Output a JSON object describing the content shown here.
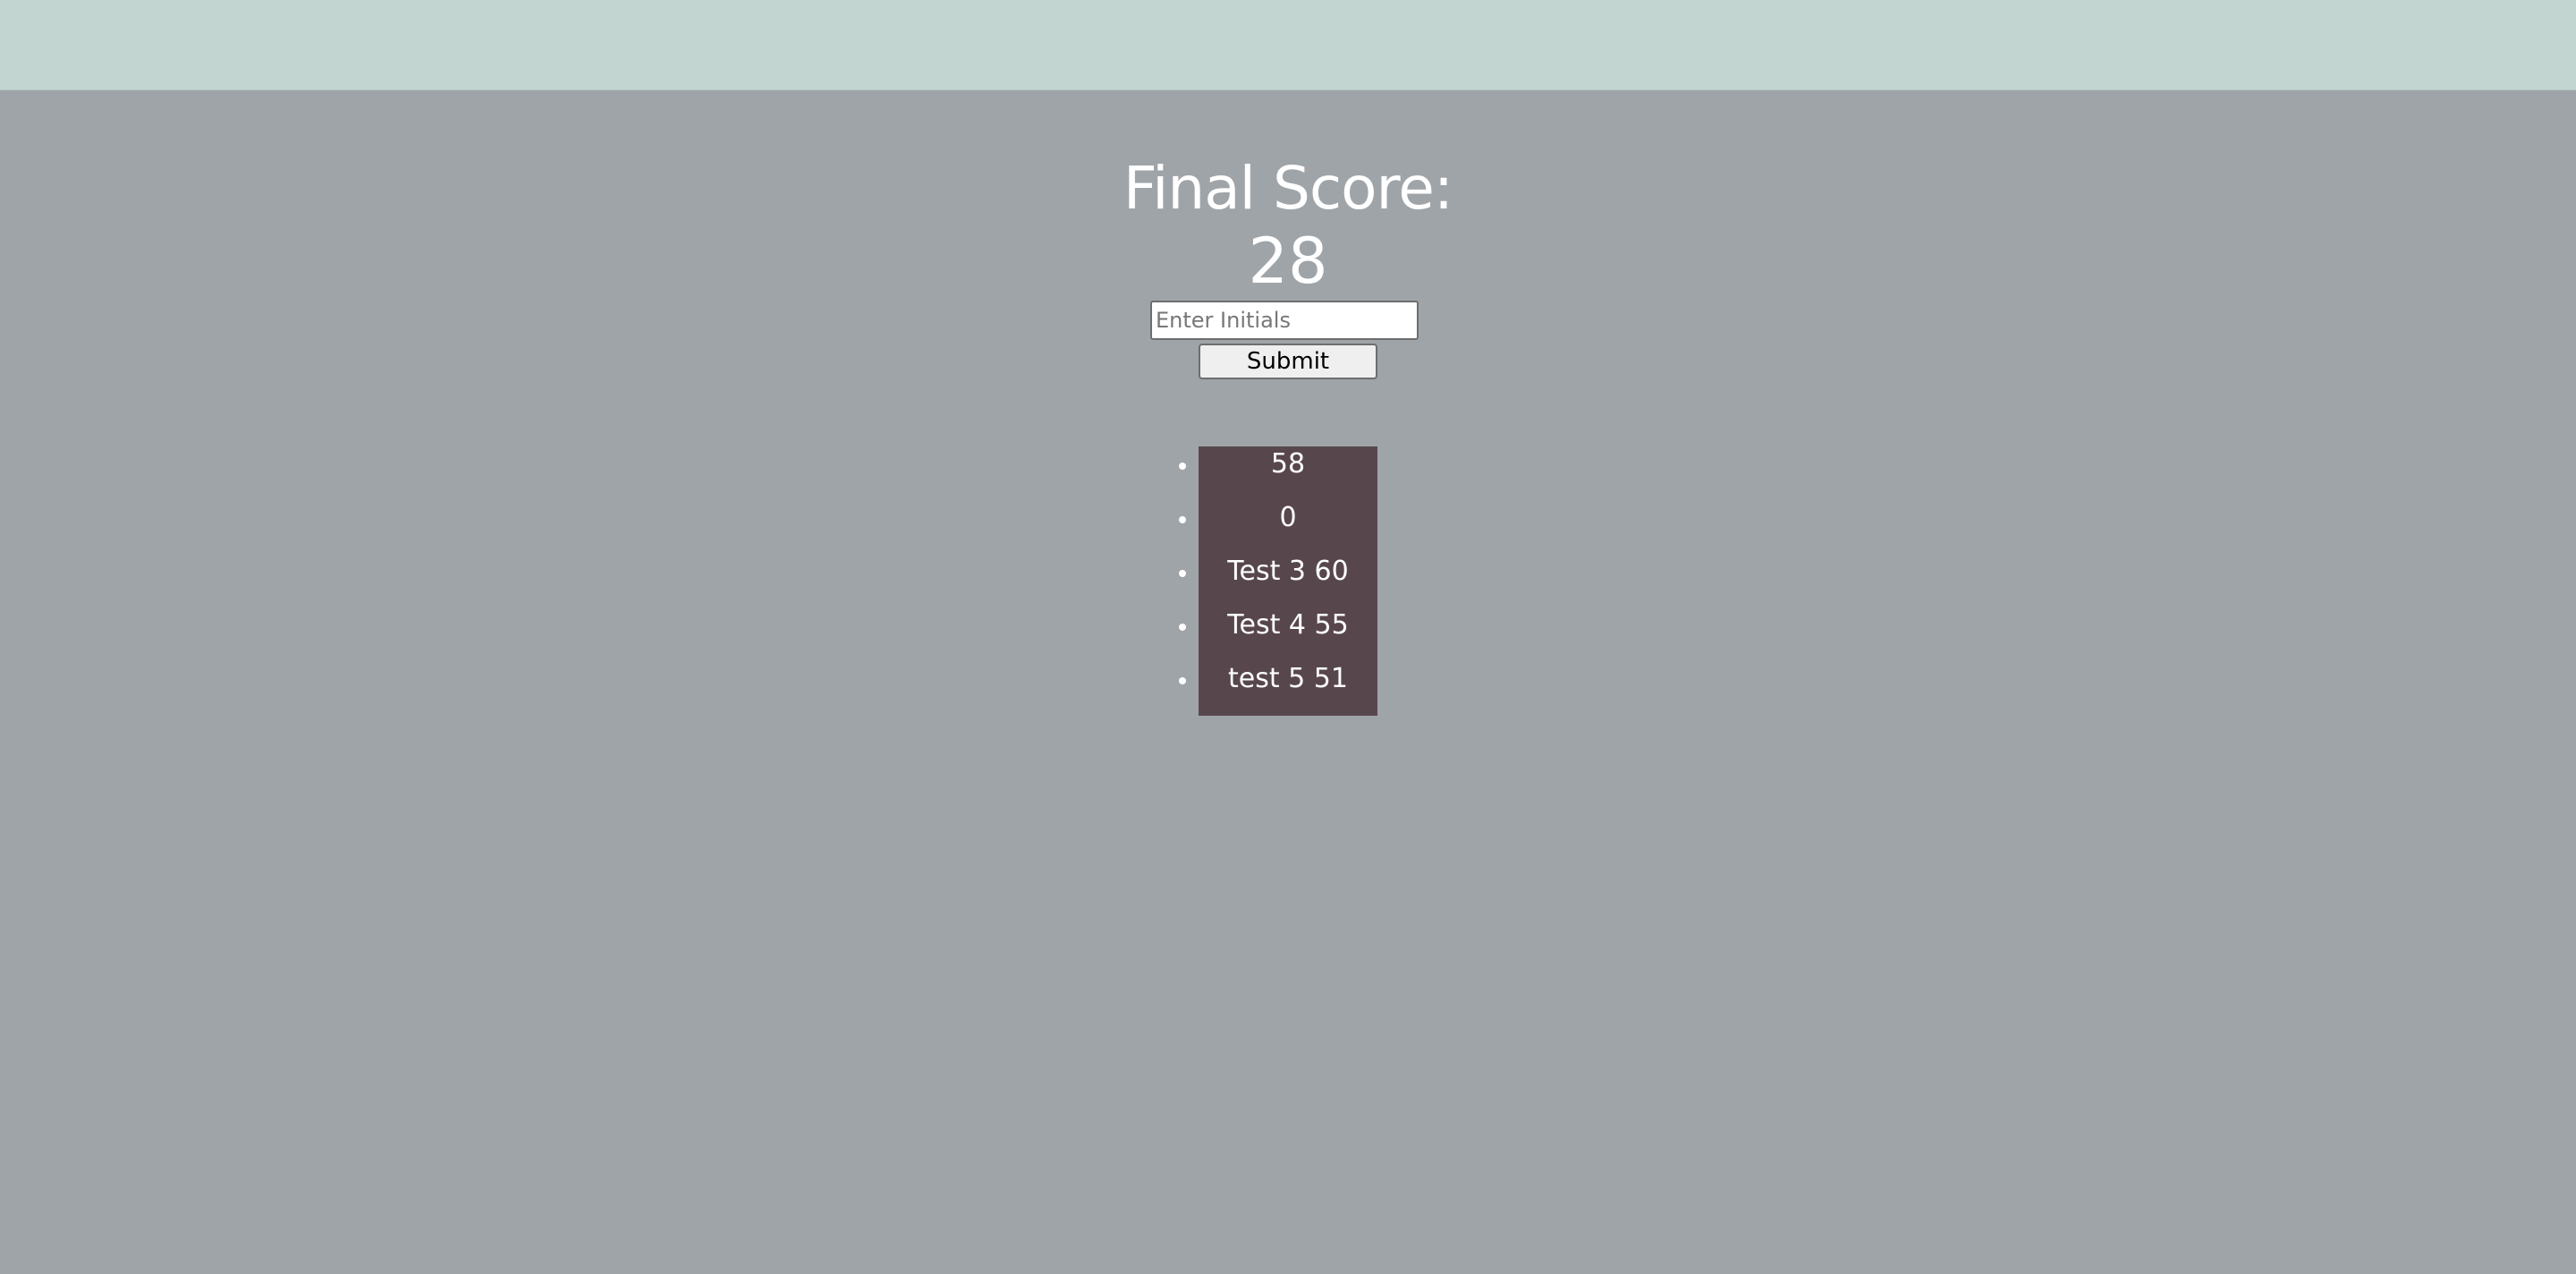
{
  "final_score": {
    "label": "Final Score:",
    "value": "28"
  },
  "initials_input": {
    "placeholder": "Enter Initials",
    "value": ""
  },
  "submit_label": "Submit",
  "high_scores": [
    "58",
    "0",
    "Test 3 60",
    "Test 4 55",
    "test 5 51"
  ],
  "colors": {
    "page_background": "#9fa4a8",
    "top_bar": "#c3d5d1",
    "list_background": "#57474d",
    "text": "#ffffff"
  }
}
